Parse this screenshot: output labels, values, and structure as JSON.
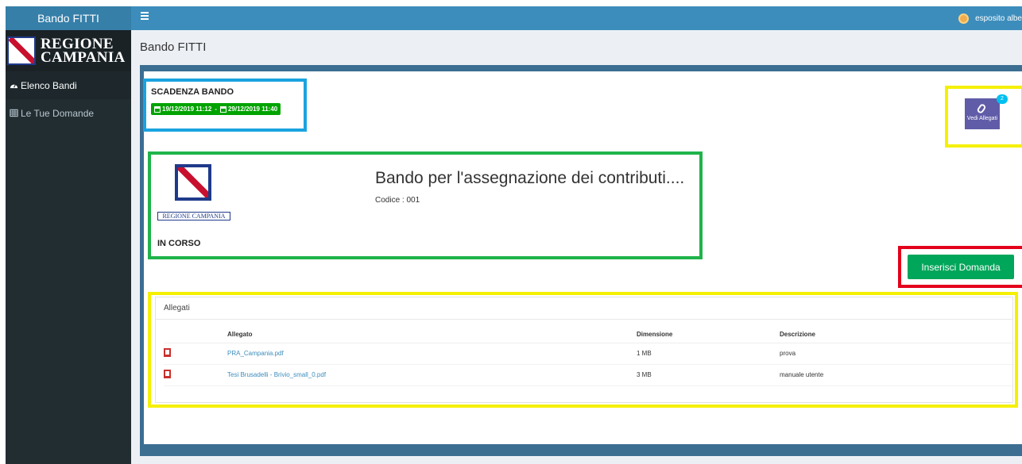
{
  "app": {
    "brand": "Bando FITTI",
    "logo_text_1": "REGIONE",
    "logo_text_2": "CAMPANIA"
  },
  "sidebar": {
    "items": [
      {
        "label": "Elenco Bandi",
        "icon": "dashboard-icon",
        "active": true
      },
      {
        "label": "Le Tue Domande",
        "icon": "table-icon",
        "active": false
      }
    ]
  },
  "header": {
    "user": "esposito albe"
  },
  "page": {
    "title": "Bando FITTI"
  },
  "scadenza": {
    "title": "SCADENZA BANDO",
    "start": "19/12/2019 11:12",
    "separator": "-",
    "end": "29/12/2019 11:40"
  },
  "allegati_button": {
    "label": "Vedi Allegati",
    "count": "2",
    "color": "#605ca8"
  },
  "bando": {
    "logo_text": "REGIONE CAMPANIA",
    "status": "IN CORSO",
    "title": "Bando per l'assegnazione dei contributi....",
    "code": "Codice : 001"
  },
  "actions": {
    "inserisci_label": "Inserisci Domanda",
    "color": "#00a65a"
  },
  "allegati": {
    "panel_title": "Allegati",
    "columns": [
      "Allegato",
      "Dimensione",
      "Descrizione"
    ],
    "rows": [
      {
        "name": "PRA_Campania.pdf",
        "size": "1 MB",
        "description": "prova"
      },
      {
        "name": "Tesi Brusadelli - Brivio_small_0.pdf",
        "size": "3 MB",
        "description": "manuale utente"
      }
    ]
  }
}
